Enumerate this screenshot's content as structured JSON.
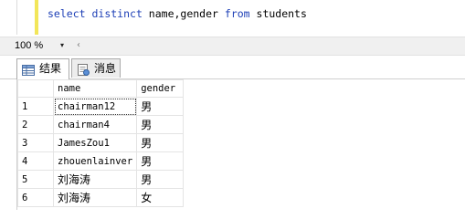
{
  "editor": {
    "tokens": [
      {
        "text": "select",
        "kw": true
      },
      {
        "text": " ",
        "kw": false
      },
      {
        "text": "distinct",
        "kw": true
      },
      {
        "text": " name,gender ",
        "kw": false
      },
      {
        "text": "from",
        "kw": true
      },
      {
        "text": " students",
        "kw": false
      }
    ]
  },
  "zoom": {
    "value": "100 %",
    "arrow": "▾",
    "scroll_left": "‹"
  },
  "tabs": {
    "results_label": "结果",
    "messages_label": "消息"
  },
  "grid": {
    "columns": [
      "name",
      "gender"
    ],
    "rows": [
      {
        "num": "1",
        "name": "chairman12",
        "gender": "男"
      },
      {
        "num": "2",
        "name": "chairman4",
        "gender": "男"
      },
      {
        "num": "3",
        "name": "JamesZou1",
        "gender": "男"
      },
      {
        "num": "4",
        "name": "zhouenlainver",
        "gender": "男"
      },
      {
        "num": "5",
        "name": "刘海涛",
        "gender": "男"
      },
      {
        "num": "6",
        "name": "刘海涛",
        "gender": "女"
      }
    ]
  },
  "colors": {
    "keyword": "#1d3fb6",
    "change_bar": "#f2e65a"
  }
}
